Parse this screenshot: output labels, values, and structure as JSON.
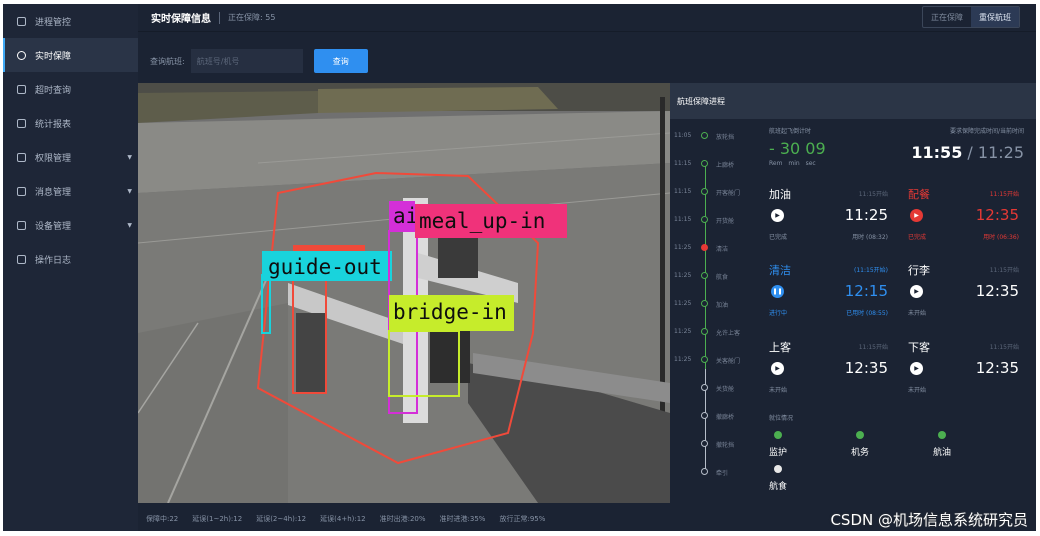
{
  "sidebar": {
    "items": [
      {
        "label": "进程管控",
        "icon": "clipboard-icon",
        "active": false,
        "has_caret": false
      },
      {
        "label": "实时保障",
        "icon": "camera-icon",
        "active": true,
        "has_caret": false
      },
      {
        "label": "超时查询",
        "icon": "calendar-icon",
        "active": false,
        "has_caret": false
      },
      {
        "label": "统计报表",
        "icon": "bar-chart-icon",
        "active": false,
        "has_caret": false
      },
      {
        "label": "权限管理",
        "icon": "user-card-icon",
        "active": false,
        "has_caret": true
      },
      {
        "label": "消息管理",
        "icon": "message-icon",
        "active": false,
        "has_caret": true
      },
      {
        "label": "设备管理",
        "icon": "monitor-icon",
        "active": false,
        "has_caret": true
      },
      {
        "label": "操作日志",
        "icon": "log-icon",
        "active": false,
        "has_caret": false
      }
    ]
  },
  "header": {
    "title": "实时保障信息",
    "subtitle": "正在保障: 55",
    "toggle": [
      "正在保障",
      "重保航班"
    ]
  },
  "search": {
    "label": "查询航班:",
    "placeholder": "航班号/机号",
    "button": "查询"
  },
  "video": {
    "detections": [
      {
        "label": "guide-out",
        "color": "#19d3dc"
      },
      {
        "label": "bridge-in",
        "color": "#c6ec2b"
      },
      {
        "label": "meal_up-in",
        "color": "#f0327a"
      },
      {
        "label": "ai",
        "color": "#d42fd8"
      }
    ]
  },
  "panel": {
    "title": "航班保障进程",
    "timeline": [
      {
        "time": "11:05",
        "name": "放轮挡",
        "state": "done"
      },
      {
        "time": "11:15",
        "name": "上廊桥",
        "state": "done"
      },
      {
        "time": "11:15",
        "name": "开客舱门",
        "state": "done"
      },
      {
        "time": "11:15",
        "name": "开货舱",
        "state": "done"
      },
      {
        "time": "11:25",
        "name": "清洁",
        "state": "current"
      },
      {
        "time": "11:25",
        "name": "航食",
        "state": "done"
      },
      {
        "time": "11:25",
        "name": "加油",
        "state": "done"
      },
      {
        "time": "11:25",
        "name": "允许上客",
        "state": "done"
      },
      {
        "time": "11:25",
        "name": "关客舱门",
        "state": "done"
      },
      {
        "time": "",
        "name": "关货舱",
        "state": "pending"
      },
      {
        "time": "",
        "name": "撤廊桥",
        "state": "pending"
      },
      {
        "time": "",
        "name": "撤轮挡",
        "state": "pending"
      },
      {
        "time": "",
        "name": "牵引",
        "state": "pending"
      }
    ],
    "countdown": {
      "label": "航班起飞倒计时",
      "value": "- 30 09",
      "units": "Rem min sec"
    },
    "finish": {
      "label": "要求保障完成时间/当前时间",
      "required": "11:55",
      "slash": " / ",
      "current": "11:25"
    },
    "tasks": [
      {
        "name": "加油",
        "state_text": "11:15开始",
        "time": "11:25",
        "status": "已完成",
        "actual": "用时 (08:32)",
        "tone": "white"
      },
      {
        "name": "配餐",
        "state_text": "11:15开始",
        "time": "12:35",
        "status": "已完成",
        "actual": "用时 (06:36)",
        "tone": "red"
      },
      {
        "name": "清洁",
        "state_text": "(11:15开始)",
        "time": "12:15",
        "status": "进行中",
        "actual": "已用时 (08:55)",
        "tone": "blue"
      },
      {
        "name": "行李",
        "state_text": "11:15开始",
        "time": "12:35",
        "status": "未开始",
        "actual": "",
        "tone": "white"
      },
      {
        "name": "上客",
        "state_text": "11:15开始",
        "time": "12:35",
        "status": "未开始",
        "actual": "",
        "tone": "white"
      },
      {
        "name": "下客",
        "state_text": "11:15开始",
        "time": "12:35",
        "status": "未开始",
        "actual": "",
        "tone": "white"
      }
    ],
    "staff": {
      "label": "就位情况",
      "items": [
        {
          "name": "监护",
          "present": true
        },
        {
          "name": "机务",
          "present": true
        },
        {
          "name": "航油",
          "present": true
        },
        {
          "name": "航食",
          "present": false
        }
      ]
    }
  },
  "stats": [
    "保障中:22",
    "延误(1~2h):12",
    "延误(2~4h):12",
    "延误(4+h):12",
    "准时出港:20%",
    "准时进港:35%",
    "放行正常:95%"
  ],
  "watermark": "CSDN @机场信息系统研究员",
  "colors": {
    "accent": "#2f8ff0",
    "done": "#4caf50",
    "alert": "#e53935",
    "background": "#1b2333"
  }
}
